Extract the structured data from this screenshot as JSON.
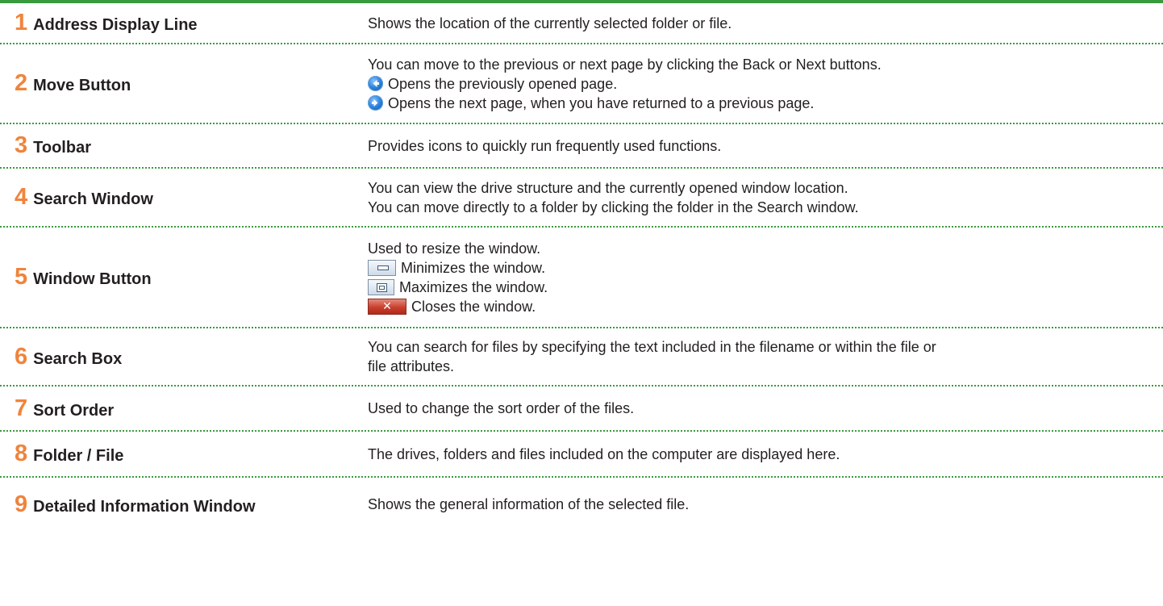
{
  "colors": {
    "accent_green": "#3a9a3f",
    "number_orange": "#f0843c"
  },
  "rows": [
    {
      "number": "1",
      "label": "Address Display Line",
      "lines": [
        {
          "text": "Shows the location of the currently selected folder or file."
        }
      ]
    },
    {
      "number": "2",
      "label": "Move Button",
      "lines": [
        {
          "text": "You can move to the previous or next page by clicking the Back or Next buttons."
        },
        {
          "icon": "back-arrow-icon",
          "text": "Opens the previously opened page."
        },
        {
          "icon": "forward-arrow-icon",
          "text": "Opens the next page, when you have returned to a previous page."
        }
      ]
    },
    {
      "number": "3",
      "label": "Toolbar",
      "lines": [
        {
          "text": "Provides icons to quickly run frequently used functions."
        }
      ]
    },
    {
      "number": "4",
      "label": "Search Window",
      "lines": [
        {
          "text": "You can view the drive structure and the currently opened window location."
        },
        {
          "text": "You can move directly to a folder by clicking the folder in the Search window."
        }
      ]
    },
    {
      "number": "5",
      "label": "Window Button",
      "lines": [
        {
          "text": "Used to resize the window."
        },
        {
          "icon": "minimize-icon",
          "text": "Minimizes the window."
        },
        {
          "icon": "maximize-icon",
          "text": "Maximizes the window."
        },
        {
          "icon": "close-icon",
          "text": "Closes the window."
        }
      ]
    },
    {
      "number": "6",
      "label": "Search Box",
      "lines": [
        {
          "text": "You can search for files by specifying the text included in the filename or within the file or"
        },
        {
          "text": "file attributes."
        }
      ]
    },
    {
      "number": "7",
      "label": "Sort Order",
      "lines": [
        {
          "text": "Used to change the sort order of the files."
        }
      ]
    },
    {
      "number": "8",
      "label": "Folder / File",
      "lines": [
        {
          "text": "The drives, folders and files included on the computer are displayed here."
        }
      ]
    },
    {
      "number": "9",
      "label": "Detailed Information Window",
      "lines": [
        {
          "text": "Shows the general information of the selected file."
        }
      ]
    }
  ]
}
